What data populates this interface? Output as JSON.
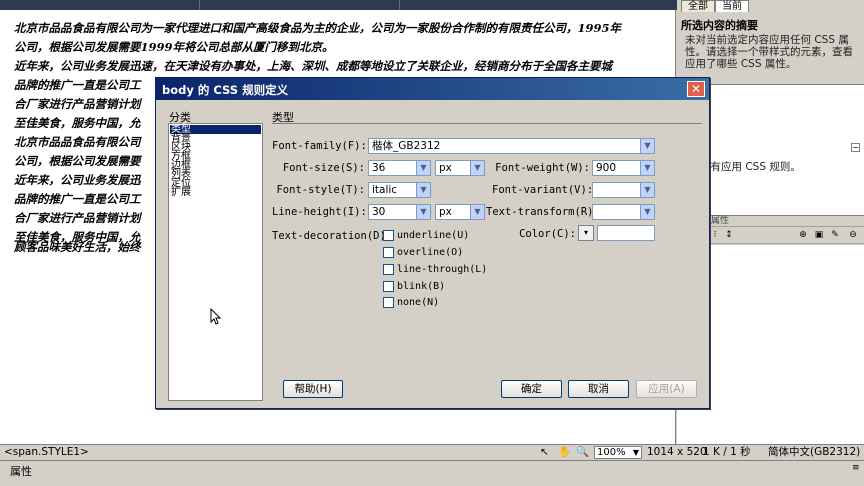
{
  "editor": {
    "lines": [
      "北京市品品食品有限公司为一家代理进口和国产高级食品为主的企业，公司为一家股份合作制的有限责任公司，1995年",
      "公司，根据公司发展需要1999年将公司总部从厦门移到北京。",
      "近年来，公司业务发展迅速，在天津设有办事处，上海、深圳、成都等地设立了关联企业，经销商分布于全国各主要城",
      "品牌的推广一直是公司工",
      "合厂家进行产品营销计划",
      "至佳美食，服务中国，允",
      "北京市品品食品有限公司",
      "公司，根据公司发展需要",
      "近年来，公司业务发展迅",
      "品牌的推广一直是公司工",
      "合厂家进行产品营销计划",
      "至佳美食，服务中国，允",
      "顾客品味美好生活，始终"
    ]
  },
  "right_panel": {
    "tabs": [
      "全部",
      "当前"
    ],
    "summary_title": "所选内容的摘要",
    "summary_text": "未对当前选定内容应用任何 CSS 属性。请选择一个带样式的元素，查看应用了哪些 CSS 属性。",
    "rules_text": "示签没有应用 CSS 规则。",
    "prop_header": "属性"
  },
  "status_bar": {
    "tag": "<span.STYLE1>",
    "zoom": "100%",
    "dimensions": "1014 x 520",
    "size_time": "1 K / 1 秒",
    "encoding": "简体中文(GB2312)"
  },
  "prop_bar": {
    "label": "属性"
  },
  "dialog": {
    "title": "body 的 CSS 规则定义",
    "category_label": "分类",
    "categories": [
      "类型",
      "背景",
      "区块",
      "方框",
      "边框",
      "列表",
      "定位",
      "扩展"
    ],
    "selected_category": "类型",
    "section_title": "类型",
    "fields": {
      "font_family_label": "Font-family(F):",
      "font_family_value": "楷体_GB2312",
      "font_size_label": "Font-size(S):",
      "font_size_value": "36",
      "font_size_unit": "px",
      "font_weight_label": "Font-weight(W):",
      "font_weight_value": "900",
      "font_style_label": "Font-style(T):",
      "font_style_value": "italic",
      "font_variant_label": "Font-variant(V):",
      "font_variant_value": "",
      "line_height_label": "Line-height(I):",
      "line_height_value": "30",
      "line_height_unit": "px",
      "text_transform_label": "Text-transform(R):",
      "text_transform_value": "",
      "text_decoration_label": "Text-decoration(D):",
      "color_label": "Color(C):",
      "color_value": ""
    },
    "decorations": [
      {
        "label": "underline(U)",
        "checked": false
      },
      {
        "label": "overline(O)",
        "checked": false
      },
      {
        "label": "line-through(L)",
        "checked": false
      },
      {
        "label": "blink(B)",
        "checked": false
      },
      {
        "label": "none(N)",
        "checked": false
      }
    ],
    "buttons": {
      "help": "帮助(H)",
      "ok": "确定",
      "cancel": "取消",
      "apply": "应用(A)"
    }
  },
  "colors": {
    "titlebar_start": "#0a246a",
    "titlebar_end": "#3a6ea5",
    "selection": "#0a246a",
    "close_button": "#e0604a"
  }
}
